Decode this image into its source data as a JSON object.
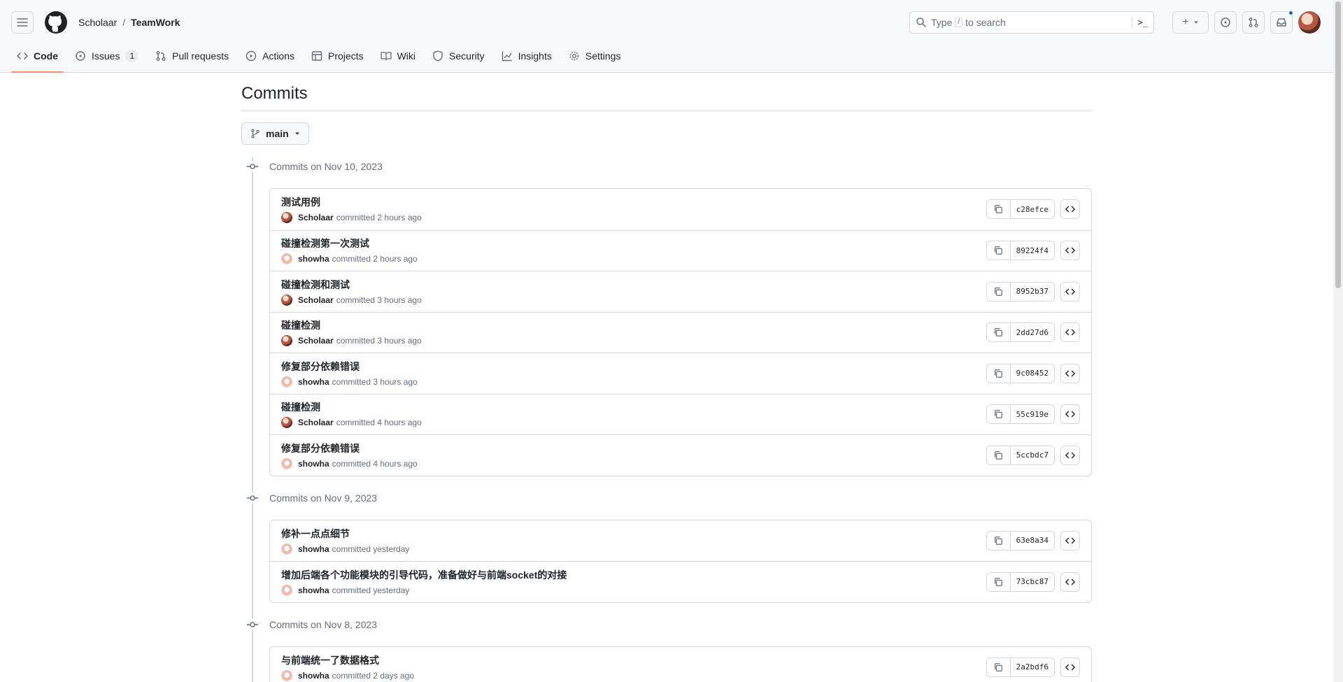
{
  "header": {
    "owner": "Scholaar",
    "separator": "/",
    "repo": "TeamWork",
    "search_prefix": "Type",
    "search_key": "/",
    "search_suffix": "to search",
    "command_palette": ">_"
  },
  "tabs": [
    {
      "label": "Code",
      "icon": "code-icon"
    },
    {
      "label": "Issues",
      "icon": "issue-icon",
      "count": "1"
    },
    {
      "label": "Pull requests",
      "icon": "pull-request-icon"
    },
    {
      "label": "Actions",
      "icon": "play-icon"
    },
    {
      "label": "Projects",
      "icon": "table-icon"
    },
    {
      "label": "Wiki",
      "icon": "book-icon"
    },
    {
      "label": "Security",
      "icon": "shield-icon"
    },
    {
      "label": "Insights",
      "icon": "graph-icon"
    },
    {
      "label": "Settings",
      "icon": "gear-icon"
    }
  ],
  "page": {
    "title": "Commits",
    "branch": "main"
  },
  "groups": [
    {
      "date_label": "Commits on Nov 10, 2023",
      "commits": [
        {
          "message": "测试用例",
          "author": "Scholaar",
          "when": "committed 2 hours ago",
          "sha": "c28efce"
        },
        {
          "message": "碰撞检测第一次测试",
          "author": "showha",
          "when": "committed 2 hours ago",
          "sha": "89224f4"
        },
        {
          "message": "碰撞检测和测试",
          "author": "Scholaar",
          "when": "committed 3 hours ago",
          "sha": "8952b37"
        },
        {
          "message": "碰撞检测",
          "author": "Scholaar",
          "when": "committed 3 hours ago",
          "sha": "2dd27d6"
        },
        {
          "message": "修复部分依赖错误",
          "author": "showha",
          "when": "committed 3 hours ago",
          "sha": "9c08452"
        },
        {
          "message": "碰撞检测",
          "author": "Scholaar",
          "when": "committed 4 hours ago",
          "sha": "55c919e"
        },
        {
          "message": "修复部分依赖错误",
          "author": "showha",
          "when": "committed 4 hours ago",
          "sha": "5ccbdc7"
        }
      ]
    },
    {
      "date_label": "Commits on Nov 9, 2023",
      "commits": [
        {
          "message": "修补一点点细节",
          "author": "showha",
          "when": "committed yesterday",
          "sha": "63e8a34"
        },
        {
          "message": "增加后端各个功能模块的引导代码，准备做好与前端socket的对接",
          "author": "showha",
          "when": "committed yesterday",
          "sha": "73cbc87"
        }
      ]
    },
    {
      "date_label": "Commits on Nov 8, 2023",
      "commits": [
        {
          "message": "与前端统一了数据格式",
          "author": "showha",
          "when": "committed 2 days ago",
          "sha": "2a2bdf6"
        }
      ]
    }
  ]
}
